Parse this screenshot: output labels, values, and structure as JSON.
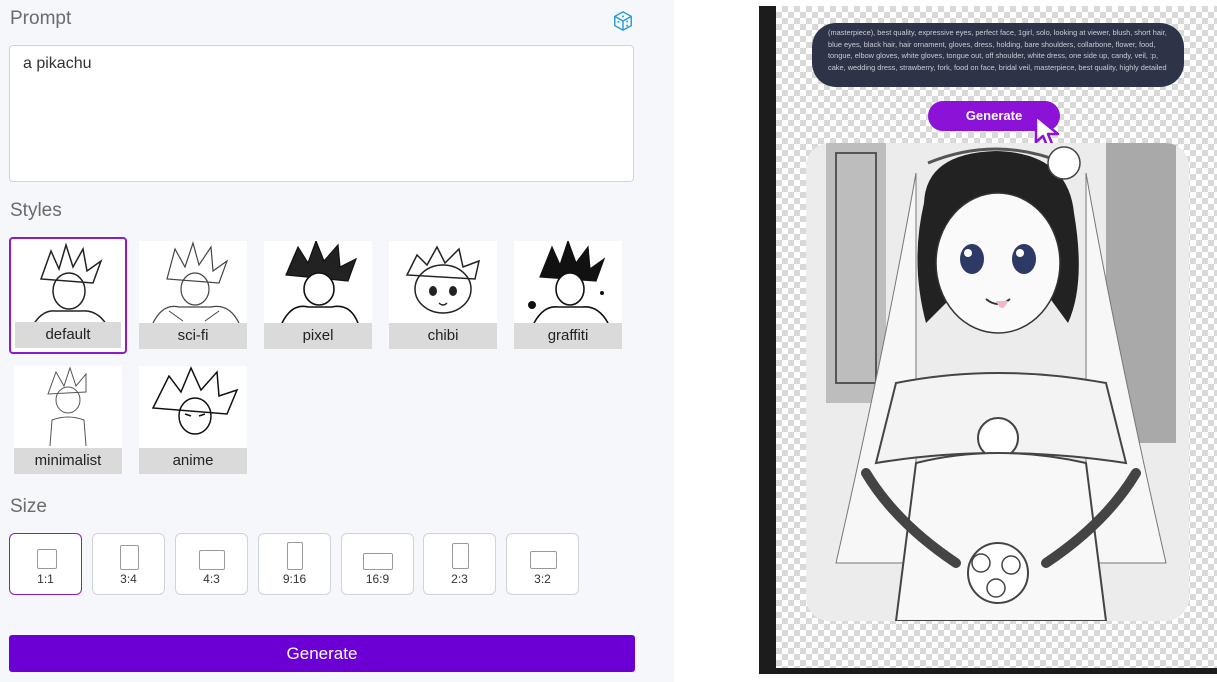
{
  "prompt": {
    "label": "Prompt",
    "value": "a pikachu"
  },
  "styles": {
    "label": "Styles",
    "items": [
      {
        "label": "default",
        "selected": true
      },
      {
        "label": "sci-fi",
        "selected": false
      },
      {
        "label": "pixel",
        "selected": false
      },
      {
        "label": "chibi",
        "selected": false
      },
      {
        "label": "graffiti",
        "selected": false
      },
      {
        "label": "minimalist",
        "selected": false
      },
      {
        "label": "anime",
        "selected": false
      }
    ]
  },
  "size": {
    "label": "Size",
    "options": [
      {
        "label": "1:1",
        "selected": true
      },
      {
        "label": "3:4",
        "selected": false
      },
      {
        "label": "4:3",
        "selected": false
      },
      {
        "label": "9:16",
        "selected": false
      },
      {
        "label": "16:9",
        "selected": false
      },
      {
        "label": "2:3",
        "selected": false
      },
      {
        "label": "3:2",
        "selected": false
      }
    ]
  },
  "generate_label": "Generate",
  "preview": {
    "overlay_prompt": "(masterpiece), best quality, expressive eyes, perfect face, 1girl, solo, looking at viewer, blush, short hair, blue eyes, black hair, hair ornament, gloves, dress, holding, bare shoulders, collarbone, flower, food, tongue, elbow gloves, white gloves, tongue out, off shoulder, white dress, one side up, candy, veil, :p, cake, wedding dress, strawberry, fork, food on face, bridal veil, masterpiece, best quality, highly detailed",
    "overlay_button": "Generate"
  },
  "colors": {
    "accent": "#6c00d4",
    "selected_border": "#8a1bd1",
    "dice_icon": "#2a9fd6",
    "overlay_bg": "#2e3348"
  },
  "icons": {
    "randomize": "dice-icon",
    "pointer": "cursor-icon"
  }
}
